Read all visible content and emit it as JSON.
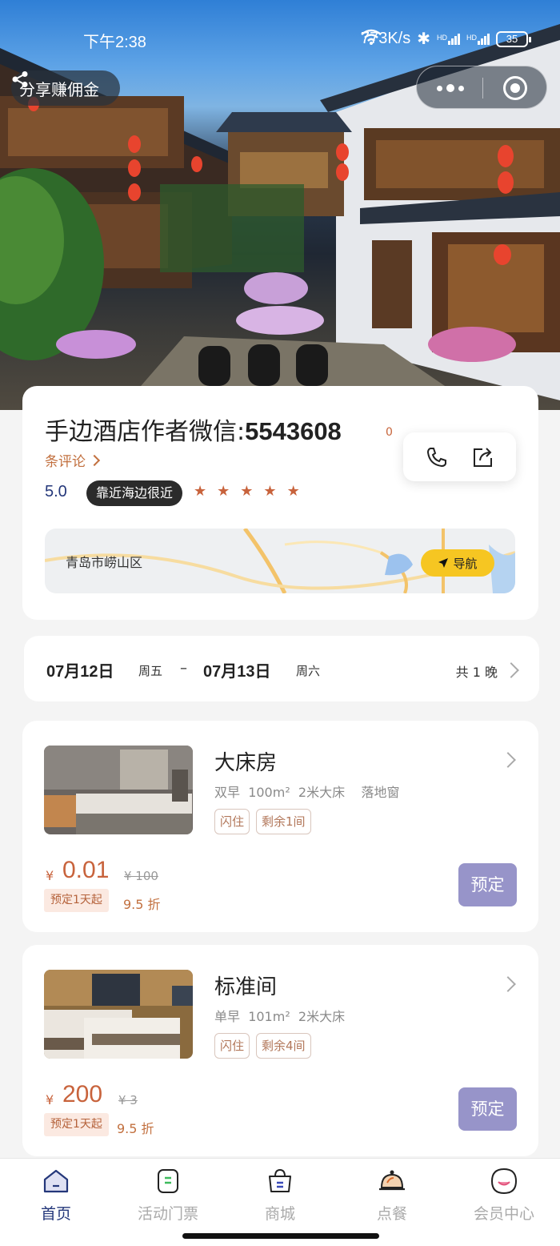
{
  "status_bar": {
    "time": "下午2:38",
    "speed": "773K/s",
    "signal_hd_1": "HD",
    "signal_hd_2": "HD",
    "battery": "35"
  },
  "hero": {
    "share_label": "分享赚佣金"
  },
  "hotel": {
    "name_prefix": "手边酒店作者微信:",
    "name_number": "5543608",
    "review_count": "0",
    "review_label": "条评论",
    "rating": "5.0",
    "tag": "靠近海边很近",
    "stars": 5,
    "location": "青岛市崂山区",
    "navigate_label": "导航"
  },
  "dates": {
    "checkin_date": "07月12日",
    "checkin_weekday": "周五",
    "separator": "–",
    "checkout_date": "07月13日",
    "checkout_weekday": "周六",
    "nights": "共 1 晚"
  },
  "rooms": [
    {
      "name": "大床房",
      "features": [
        "双早",
        "100m²",
        "2米大床",
        "落地窗"
      ],
      "tags": [
        "闪住",
        "剩余1间"
      ],
      "currency": "¥",
      "price": "0.01",
      "original_price": "¥ 100",
      "min_stay": "预定1天起",
      "discount": "9.5 折",
      "book_label": "预定"
    },
    {
      "name": "标准间",
      "features": [
        "单早",
        "101m²",
        "2米大床"
      ],
      "tags": [
        "闪住",
        "剩余4间"
      ],
      "currency": "¥",
      "price": "200",
      "original_price": "¥ 3",
      "min_stay": "预定1天起",
      "discount": "9.5 折",
      "book_label": "预定"
    }
  ],
  "tabbar": {
    "items": [
      {
        "label": "首页",
        "icon": "home-icon",
        "active": true
      },
      {
        "label": "活动门票",
        "icon": "ticket-icon",
        "active": false
      },
      {
        "label": "商城",
        "icon": "shopping-bag-icon",
        "active": false
      },
      {
        "label": "点餐",
        "icon": "dining-bell-icon",
        "active": false
      },
      {
        "label": "会员中心",
        "icon": "member-smile-icon",
        "active": false
      }
    ]
  },
  "colors": {
    "accent_price": "#c8633c",
    "book_button": "#9794c9",
    "active_tab": "#24377a",
    "nav_button": "#f6c622"
  }
}
